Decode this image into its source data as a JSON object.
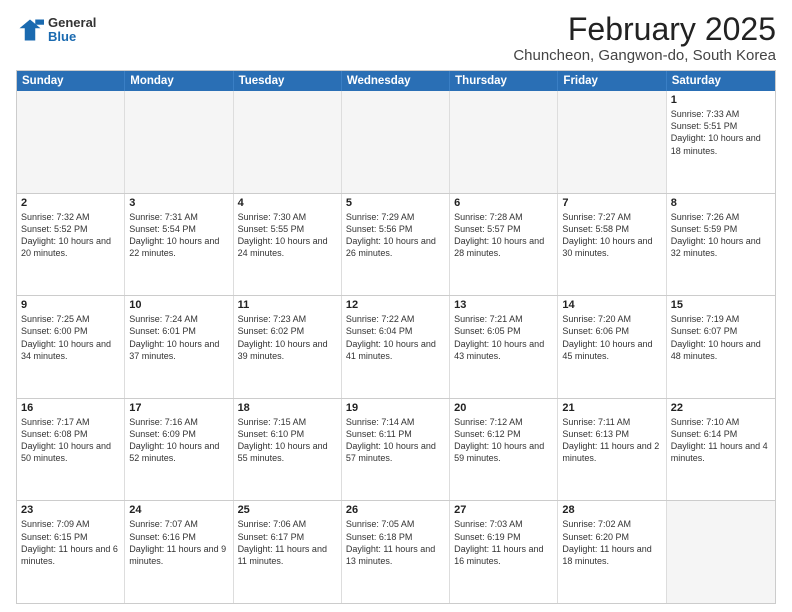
{
  "header": {
    "logo": {
      "general": "General",
      "blue": "Blue"
    },
    "title": "February 2025",
    "subtitle": "Chuncheon, Gangwon-do, South Korea"
  },
  "calendar": {
    "days_of_week": [
      "Sunday",
      "Monday",
      "Tuesday",
      "Wednesday",
      "Thursday",
      "Friday",
      "Saturday"
    ],
    "weeks": [
      [
        {
          "day": "",
          "empty": true
        },
        {
          "day": "",
          "empty": true
        },
        {
          "day": "",
          "empty": true
        },
        {
          "day": "",
          "empty": true
        },
        {
          "day": "",
          "empty": true
        },
        {
          "day": "",
          "empty": true
        },
        {
          "day": "1",
          "sunrise": "7:33 AM",
          "sunset": "5:51 PM",
          "daylight": "10 hours and 18 minutes."
        }
      ],
      [
        {
          "day": "2",
          "sunrise": "7:32 AM",
          "sunset": "5:52 PM",
          "daylight": "10 hours and 20 minutes."
        },
        {
          "day": "3",
          "sunrise": "7:31 AM",
          "sunset": "5:54 PM",
          "daylight": "10 hours and 22 minutes."
        },
        {
          "day": "4",
          "sunrise": "7:30 AM",
          "sunset": "5:55 PM",
          "daylight": "10 hours and 24 minutes."
        },
        {
          "day": "5",
          "sunrise": "7:29 AM",
          "sunset": "5:56 PM",
          "daylight": "10 hours and 26 minutes."
        },
        {
          "day": "6",
          "sunrise": "7:28 AM",
          "sunset": "5:57 PM",
          "daylight": "10 hours and 28 minutes."
        },
        {
          "day": "7",
          "sunrise": "7:27 AM",
          "sunset": "5:58 PM",
          "daylight": "10 hours and 30 minutes."
        },
        {
          "day": "8",
          "sunrise": "7:26 AM",
          "sunset": "5:59 PM",
          "daylight": "10 hours and 32 minutes."
        }
      ],
      [
        {
          "day": "9",
          "sunrise": "7:25 AM",
          "sunset": "6:00 PM",
          "daylight": "10 hours and 34 minutes."
        },
        {
          "day": "10",
          "sunrise": "7:24 AM",
          "sunset": "6:01 PM",
          "daylight": "10 hours and 37 minutes."
        },
        {
          "day": "11",
          "sunrise": "7:23 AM",
          "sunset": "6:02 PM",
          "daylight": "10 hours and 39 minutes."
        },
        {
          "day": "12",
          "sunrise": "7:22 AM",
          "sunset": "6:04 PM",
          "daylight": "10 hours and 41 minutes."
        },
        {
          "day": "13",
          "sunrise": "7:21 AM",
          "sunset": "6:05 PM",
          "daylight": "10 hours and 43 minutes."
        },
        {
          "day": "14",
          "sunrise": "7:20 AM",
          "sunset": "6:06 PM",
          "daylight": "10 hours and 45 minutes."
        },
        {
          "day": "15",
          "sunrise": "7:19 AM",
          "sunset": "6:07 PM",
          "daylight": "10 hours and 48 minutes."
        }
      ],
      [
        {
          "day": "16",
          "sunrise": "7:17 AM",
          "sunset": "6:08 PM",
          "daylight": "10 hours and 50 minutes."
        },
        {
          "day": "17",
          "sunrise": "7:16 AM",
          "sunset": "6:09 PM",
          "daylight": "10 hours and 52 minutes."
        },
        {
          "day": "18",
          "sunrise": "7:15 AM",
          "sunset": "6:10 PM",
          "daylight": "10 hours and 55 minutes."
        },
        {
          "day": "19",
          "sunrise": "7:14 AM",
          "sunset": "6:11 PM",
          "daylight": "10 hours and 57 minutes."
        },
        {
          "day": "20",
          "sunrise": "7:12 AM",
          "sunset": "6:12 PM",
          "daylight": "10 hours and 59 minutes."
        },
        {
          "day": "21",
          "sunrise": "7:11 AM",
          "sunset": "6:13 PM",
          "daylight": "11 hours and 2 minutes."
        },
        {
          "day": "22",
          "sunrise": "7:10 AM",
          "sunset": "6:14 PM",
          "daylight": "11 hours and 4 minutes."
        }
      ],
      [
        {
          "day": "23",
          "sunrise": "7:09 AM",
          "sunset": "6:15 PM",
          "daylight": "11 hours and 6 minutes."
        },
        {
          "day": "24",
          "sunrise": "7:07 AM",
          "sunset": "6:16 PM",
          "daylight": "11 hours and 9 minutes."
        },
        {
          "day": "25",
          "sunrise": "7:06 AM",
          "sunset": "6:17 PM",
          "daylight": "11 hours and 11 minutes."
        },
        {
          "day": "26",
          "sunrise": "7:05 AM",
          "sunset": "6:18 PM",
          "daylight": "11 hours and 13 minutes."
        },
        {
          "day": "27",
          "sunrise": "7:03 AM",
          "sunset": "6:19 PM",
          "daylight": "11 hours and 16 minutes."
        },
        {
          "day": "28",
          "sunrise": "7:02 AM",
          "sunset": "6:20 PM",
          "daylight": "11 hours and 18 minutes."
        },
        {
          "day": "",
          "empty": true
        }
      ]
    ]
  }
}
